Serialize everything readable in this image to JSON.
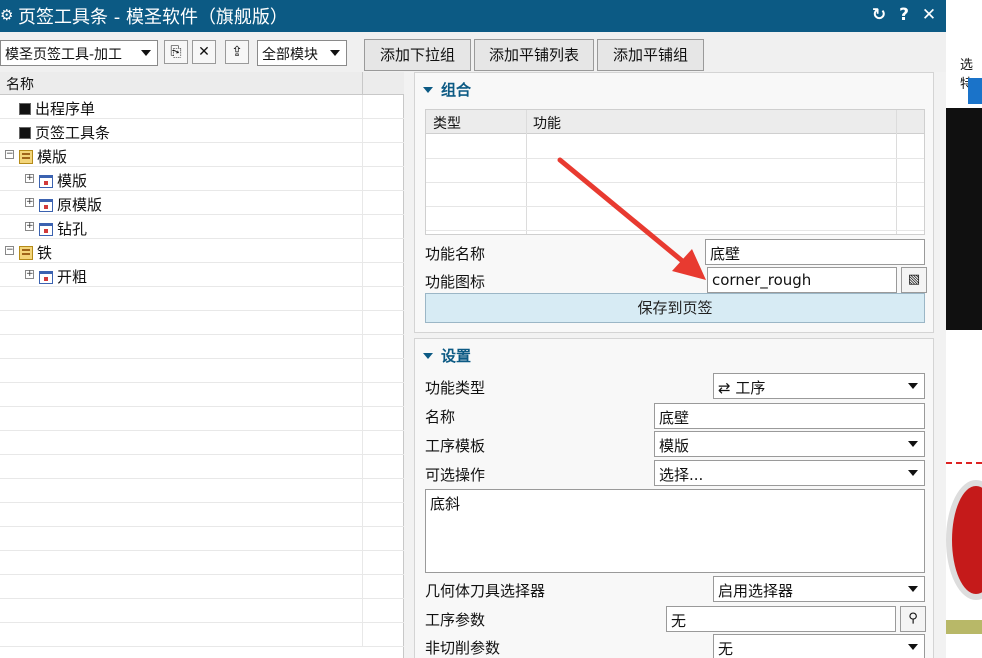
{
  "window": {
    "title": "页签工具条 - 模圣软件（旗舰版）",
    "buttons": {
      "refresh": "↻",
      "help": "?",
      "close": "✕"
    },
    "icon": "gear-icon"
  },
  "toolbar": {
    "toolbar_combo": "模圣页签工具-加工",
    "module_combo": "全部模块",
    "add_dropdown_group": "添加下拉组",
    "add_tile_list": "添加平铺列表",
    "add_tile_group": "添加平铺组"
  },
  "tree": {
    "header": "名称",
    "nodes": [
      {
        "label": "出程序单",
        "icon": "black-square-icon"
      },
      {
        "label": "页签工具条",
        "icon": "black-square-icon"
      },
      {
        "label": "模版",
        "icon": "list-folder-icon",
        "expanded": true
      },
      {
        "label": "模版",
        "icon": "calendar-icon",
        "expanded": false
      },
      {
        "label": "原模版",
        "icon": "calendar-icon",
        "expanded": false
      },
      {
        "label": "钻孔",
        "icon": "calendar-icon",
        "expanded": false
      },
      {
        "label": "铁",
        "icon": "list-folder-icon",
        "expanded": true
      },
      {
        "label": "开粗",
        "icon": "calendar-icon",
        "expanded": false
      }
    ]
  },
  "group_section": {
    "title": "组合",
    "columns": [
      "类型",
      "功能"
    ],
    "function_name_label": "功能名称",
    "function_name_value": "底壁",
    "function_icon_label": "功能图标",
    "function_icon_value": "corner_rough",
    "save_button": "保存到页签"
  },
  "settings_section": {
    "title": "设置",
    "function_type_label": "功能类型",
    "function_type_value": "工序",
    "name_label": "名称",
    "name_value": "底壁",
    "template_label": "工序模板",
    "template_value": "模版",
    "optional_op_label": "可选操作",
    "optional_op_value": "选择...",
    "note_value": "底斜",
    "geometry_tool_label": "几何体刀具选择器",
    "geometry_tool_value": "启用选择器",
    "op_params_label": "工序参数",
    "op_params_value": "无",
    "non_cut_label": "非切削参数",
    "non_cut_value": "无"
  },
  "background": {
    "partial_label": "选特"
  },
  "colors": {
    "titlebar": "#0c5a84",
    "section_title": "#0c5a84",
    "annotation_arrow": "#e83a30",
    "save_button_bg": "#d7ebf4"
  }
}
